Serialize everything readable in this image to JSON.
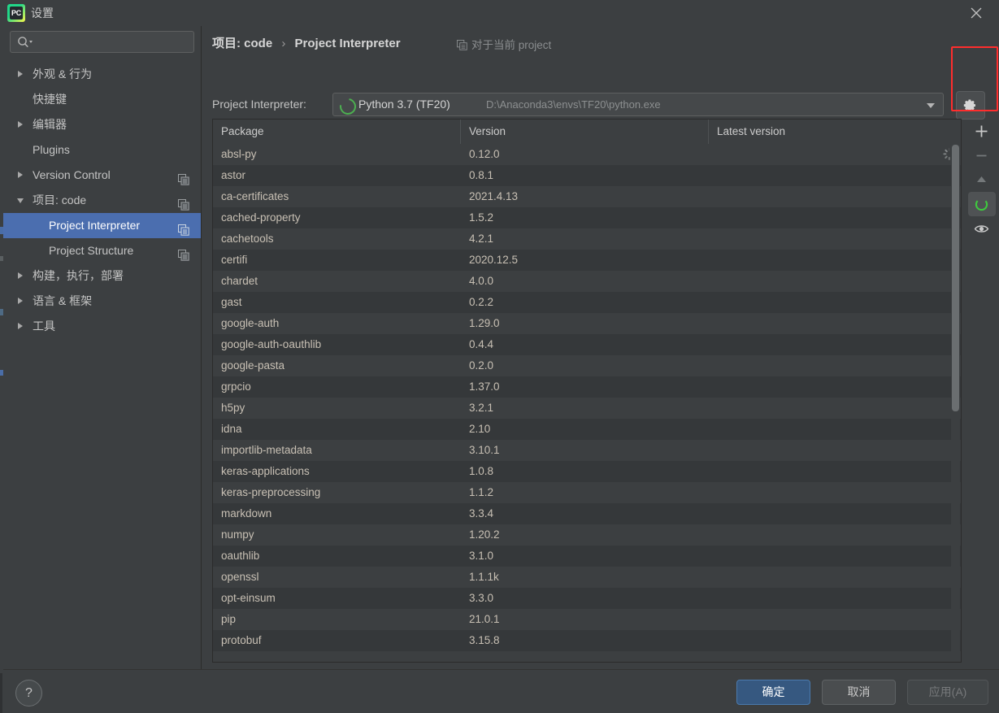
{
  "window": {
    "title": "设置",
    "logo_text": "PC",
    "close_icon": "close-icon"
  },
  "sidebar": {
    "search_placeholder": "",
    "search_value": "",
    "items": [
      {
        "label": "外观 & 行为",
        "arrow": "right",
        "indent": false,
        "selected": false,
        "copy": false
      },
      {
        "label": "快捷键",
        "arrow": "none",
        "indent": false,
        "selected": false,
        "copy": false
      },
      {
        "label": "编辑器",
        "arrow": "right",
        "indent": false,
        "selected": false,
        "copy": false
      },
      {
        "label": "Plugins",
        "arrow": "none",
        "indent": false,
        "selected": false,
        "copy": false
      },
      {
        "label": "Version Control",
        "arrow": "right",
        "indent": false,
        "selected": false,
        "copy": true
      },
      {
        "label": "项目: code",
        "arrow": "down",
        "indent": false,
        "selected": false,
        "copy": true
      },
      {
        "label": "Project Interpreter",
        "arrow": "none",
        "indent": true,
        "selected": true,
        "copy": true
      },
      {
        "label": "Project Structure",
        "arrow": "none",
        "indent": true,
        "selected": false,
        "copy": true
      },
      {
        "label": "构建，执行，部署",
        "arrow": "right",
        "indent": false,
        "selected": false,
        "copy": false
      },
      {
        "label": "语言 & 框架",
        "arrow": "right",
        "indent": false,
        "selected": false,
        "copy": false
      },
      {
        "label": "工具",
        "arrow": "right",
        "indent": false,
        "selected": false,
        "copy": false
      }
    ]
  },
  "main": {
    "breadcrumb_root": "项目: code",
    "breadcrumb_sep": "›",
    "breadcrumb_leaf": "Project Interpreter",
    "for_project_label": "对于当前 project",
    "interpreter_label": "Project Interpreter:",
    "interpreter_name": "Python 3.7 (TF20)",
    "interpreter_path": "D:\\Anaconda3\\envs\\TF20\\python.exe",
    "gear_icon": "gear-icon",
    "highlight_color": "#ff2d2d"
  },
  "table": {
    "columns": [
      "Package",
      "Version",
      "Latest version"
    ],
    "rows": [
      {
        "package": "absl-py",
        "version": "0.12.0",
        "latest": ""
      },
      {
        "package": "astor",
        "version": "0.8.1",
        "latest": ""
      },
      {
        "package": "ca-certificates",
        "version": "2021.4.13",
        "latest": ""
      },
      {
        "package": "cached-property",
        "version": "1.5.2",
        "latest": ""
      },
      {
        "package": "cachetools",
        "version": "4.2.1",
        "latest": ""
      },
      {
        "package": "certifi",
        "version": "2020.12.5",
        "latest": ""
      },
      {
        "package": "chardet",
        "version": "4.0.0",
        "latest": ""
      },
      {
        "package": "gast",
        "version": "0.2.2",
        "latest": ""
      },
      {
        "package": "google-auth",
        "version": "1.29.0",
        "latest": ""
      },
      {
        "package": "google-auth-oauthlib",
        "version": "0.4.4",
        "latest": ""
      },
      {
        "package": "google-pasta",
        "version": "0.2.0",
        "latest": ""
      },
      {
        "package": "grpcio",
        "version": "1.37.0",
        "latest": ""
      },
      {
        "package": "h5py",
        "version": "3.2.1",
        "latest": ""
      },
      {
        "package": "idna",
        "version": "2.10",
        "latest": ""
      },
      {
        "package": "importlib-metadata",
        "version": "3.10.1",
        "latest": ""
      },
      {
        "package": "keras-applications",
        "version": "1.0.8",
        "latest": ""
      },
      {
        "package": "keras-preprocessing",
        "version": "1.1.2",
        "latest": ""
      },
      {
        "package": "markdown",
        "version": "3.3.4",
        "latest": ""
      },
      {
        "package": "numpy",
        "version": "1.20.2",
        "latest": ""
      },
      {
        "package": "oauthlib",
        "version": "3.1.0",
        "latest": ""
      },
      {
        "package": "openssl",
        "version": "1.1.1k",
        "latest": ""
      },
      {
        "package": "opt-einsum",
        "version": "3.3.0",
        "latest": ""
      },
      {
        "package": "pip",
        "version": "21.0.1",
        "latest": ""
      },
      {
        "package": "protobuf",
        "version": "3.15.8",
        "latest": ""
      }
    ]
  },
  "toolbar": {
    "items": [
      {
        "name": "add-package-button",
        "icon": "plus-icon",
        "state": "enabled"
      },
      {
        "name": "remove-package-button",
        "icon": "minus-icon",
        "state": "disabled"
      },
      {
        "name": "upgrade-package-button",
        "icon": "up-arrow-icon",
        "state": "disabled"
      },
      {
        "name": "loading-indicator",
        "icon": "spinner-icon",
        "state": "active"
      },
      {
        "name": "show-early-releases-button",
        "icon": "eye-icon",
        "state": "enabled"
      }
    ]
  },
  "footer": {
    "help_label": "?",
    "ok_label": "确定",
    "cancel_label": "取消",
    "apply_label": "应用(A)"
  }
}
